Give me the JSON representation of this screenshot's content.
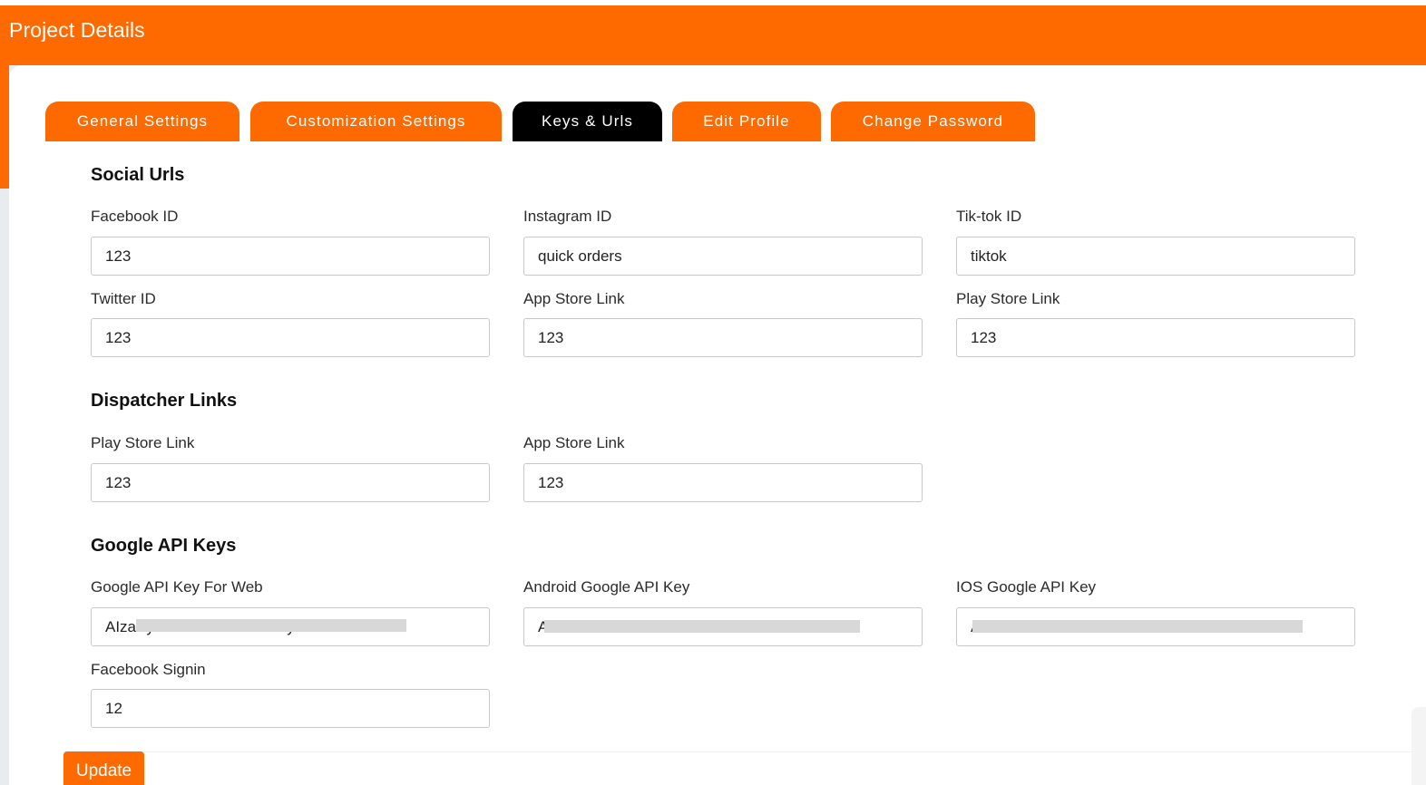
{
  "header": {
    "title": "Project Details"
  },
  "tabs": [
    {
      "label": "General Settings"
    },
    {
      "label": "Customization Settings"
    },
    {
      "label": "Keys & Urls"
    },
    {
      "label": "Edit Profile"
    },
    {
      "label": "Change Password"
    }
  ],
  "active_tab": "Keys & Urls",
  "sections": {
    "social": {
      "title": "Social Urls",
      "facebook_id": {
        "label": "Facebook ID",
        "value": "123"
      },
      "instagram_id": {
        "label": "Instagram ID",
        "value": "quick orders"
      },
      "tiktok_id": {
        "label": "Tik-tok ID",
        "value": "tiktok"
      },
      "twitter_id": {
        "label": "Twitter ID",
        "value": "123"
      },
      "app_store_link": {
        "label": "App Store Link",
        "value": "123"
      },
      "play_store_link": {
        "label": "Play Store Link",
        "value": "123"
      }
    },
    "dispatcher": {
      "title": "Dispatcher Links",
      "play_store_link": {
        "label": "Play Store Link",
        "value": "123"
      },
      "app_store_link": {
        "label": "App Store Link",
        "value": "123"
      }
    },
    "google": {
      "title": "Google API Keys",
      "web_key": {
        "label": "Google API Key For Web",
        "value": "AIzaSy                               yl"
      },
      "android_key": {
        "label": "Android Google API Key",
        "value": "A                                              3"
      },
      "ios_key": {
        "label": "IOS Google API Key",
        "value": "A"
      },
      "facebook_signin": {
        "label": "Facebook Signin",
        "value": "12"
      }
    }
  },
  "actions": {
    "update_label": "Update"
  },
  "colors": {
    "brand": "#ff6a00",
    "active_tab": "#000000"
  }
}
